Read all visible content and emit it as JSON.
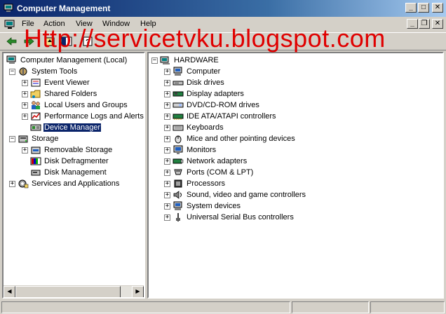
{
  "window": {
    "title": "Computer Management"
  },
  "menu": [
    "File",
    "Action",
    "View",
    "Window",
    "Help"
  ],
  "watermark": "Http://servicetvku.blogspot.com",
  "caption_buttons": {
    "minimize": "_",
    "maximize": "□",
    "close": "✕"
  },
  "mdi_buttons": {
    "minimize": "_",
    "restore": "❐",
    "close": "✕"
  },
  "left_tree": [
    {
      "label": "Computer Management (Local)",
      "icon": "computer-management-icon",
      "level": 0,
      "expander": "none"
    },
    {
      "label": "System Tools",
      "icon": "system-tools-icon",
      "level": 1,
      "expander": "-"
    },
    {
      "label": "Event Viewer",
      "icon": "event-viewer-icon",
      "level": 2,
      "expander": "+"
    },
    {
      "label": "Shared Folders",
      "icon": "shared-folders-icon",
      "level": 2,
      "expander": "+"
    },
    {
      "label": "Local Users and Groups",
      "icon": "users-groups-icon",
      "level": 2,
      "expander": "+"
    },
    {
      "label": "Performance Logs and Alerts",
      "icon": "performance-icon",
      "level": 2,
      "expander": "+"
    },
    {
      "label": "Device Manager",
      "icon": "device-manager-icon",
      "level": 2,
      "expander": "none",
      "selected": true
    },
    {
      "label": "Storage",
      "icon": "storage-icon",
      "level": 1,
      "expander": "-"
    },
    {
      "label": "Removable Storage",
      "icon": "removable-storage-icon",
      "level": 2,
      "expander": "+"
    },
    {
      "label": "Disk Defragmenter",
      "icon": "defragmenter-icon",
      "level": 2,
      "expander": "none"
    },
    {
      "label": "Disk Management",
      "icon": "disk-management-icon",
      "level": 2,
      "expander": "none"
    },
    {
      "label": "Services and Applications",
      "icon": "services-icon",
      "level": 1,
      "expander": "+"
    }
  ],
  "right_tree": {
    "root": {
      "label": "HARDWARE",
      "icon": "hardware-icon",
      "expander": "-"
    },
    "items": [
      {
        "label": "Computer",
        "icon": "computer-icon"
      },
      {
        "label": "Disk drives",
        "icon": "disk-drive-icon"
      },
      {
        "label": "Display adapters",
        "icon": "display-adapter-icon"
      },
      {
        "label": "DVD/CD-ROM drives",
        "icon": "cdrom-icon"
      },
      {
        "label": "IDE ATA/ATAPI controllers",
        "icon": "ide-controller-icon"
      },
      {
        "label": "Keyboards",
        "icon": "keyboard-icon"
      },
      {
        "label": "Mice and other pointing devices",
        "icon": "mouse-icon"
      },
      {
        "label": "Monitors",
        "icon": "monitor-icon"
      },
      {
        "label": "Network adapters",
        "icon": "network-adapter-icon"
      },
      {
        "label": "Ports (COM & LPT)",
        "icon": "port-icon"
      },
      {
        "label": "Processors",
        "icon": "processor-icon"
      },
      {
        "label": "Sound, video and game controllers",
        "icon": "sound-icon"
      },
      {
        "label": "System devices",
        "icon": "system-device-icon"
      },
      {
        "label": "Universal Serial Bus controllers",
        "icon": "usb-icon"
      }
    ]
  }
}
